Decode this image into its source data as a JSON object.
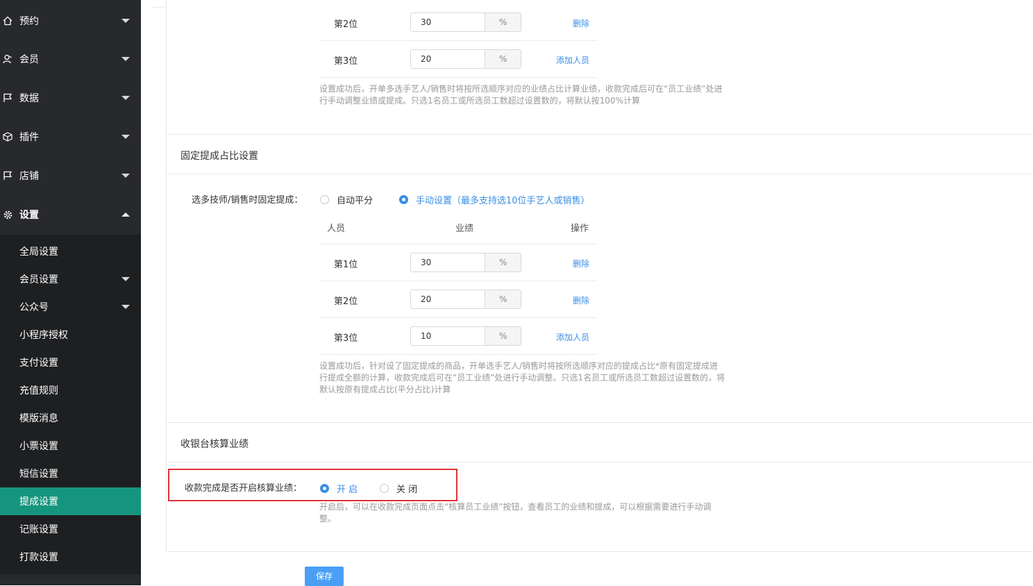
{
  "sidebar": {
    "top_items": [
      {
        "label": "预约",
        "icon": "home-icon"
      },
      {
        "label": "会员",
        "icon": "user-icon"
      },
      {
        "label": "数据",
        "icon": "flag-icon"
      },
      {
        "label": "插件",
        "icon": "cube-icon"
      },
      {
        "label": "店铺",
        "icon": "flag-icon"
      },
      {
        "label": "设置",
        "icon": "gear-icon"
      }
    ],
    "sub_items": [
      {
        "label": "全局设置"
      },
      {
        "label": "会员设置"
      },
      {
        "label": "公众号"
      },
      {
        "label": "小程序授权"
      },
      {
        "label": "支付设置"
      },
      {
        "label": "充值规则"
      },
      {
        "label": "模版消息"
      },
      {
        "label": "小票设置"
      },
      {
        "label": "短信设置"
      },
      {
        "label": "提成设置"
      },
      {
        "label": "记账设置"
      },
      {
        "label": "打款设置"
      }
    ],
    "active_sub": "提成设置",
    "active_color": "#16957e"
  },
  "performance_section": {
    "rows": [
      {
        "rank": "第2位",
        "value": "30",
        "unit": "%",
        "action": "删除"
      },
      {
        "rank": "第3位",
        "value": "20",
        "unit": "%",
        "action": "添加人员"
      }
    ],
    "hint": "设置成功后，开单多选手艺人/销售时将按所选顺序对应的业绩占比计算业绩，收款完成后可在“员工业绩”处进行手动调整业绩或提成。只选1名员工或所选员工数超过设置数的，将默认按100%计算",
    "hint_line1": "设置成功后，开单多选手艺人/销售时将按所选顺序对应的业绩占比计算业绩，收款完成后可在“员工业绩”处进",
    "hint_line2": "行手动调整业绩或提成。只选1名员工或所选员工数超过设置数的，将默认按100%计算"
  },
  "fixed_commission": {
    "title": "固定提成占比设置",
    "label": "选多技师/销售时固定提成：",
    "option_auto": "自动平分",
    "option_manual": "手动设置（最多支持选10位手艺人或销售）",
    "selected": "manual",
    "headers": {
      "person": "人员",
      "performance": "业绩",
      "action": "操作"
    },
    "rows": [
      {
        "rank": "第1位",
        "value": "30",
        "unit": "%",
        "action": "删除"
      },
      {
        "rank": "第2位",
        "value": "20",
        "unit": "%",
        "action": "删除"
      },
      {
        "rank": "第3位",
        "value": "10",
        "unit": "%",
        "action": "添加人员"
      }
    ],
    "hint_line1": "设置成功后，针对设了固定提成的商品，开单选手艺人/销售时将按所选顺序对应的提成占比*原有固定提成进",
    "hint_line2": "行提成全额的计算，收款完成后可在“员工业绩”处进行手动调整。只选1名员工或所选员工数超过设置数的，将",
    "hint_line3": "默认按原有提成占比(平分占比)计算"
  },
  "cashier": {
    "title": "收银台核算业绩",
    "label": "收款完成是否开启核算业绩：",
    "option_on": "开 启",
    "option_off": "关 闭",
    "selected": "on",
    "hint_line1": "开启后，可以在收款完成页面点击“核算员工业绩”按钮，查看员工的业绩和提成，可以根据需要进行手动调",
    "hint_line2": "整。"
  },
  "save_label": "保存",
  "colors": {
    "accent": "#3a8ee6",
    "highlight": "#e0333a",
    "button": "#4a9ff5"
  }
}
